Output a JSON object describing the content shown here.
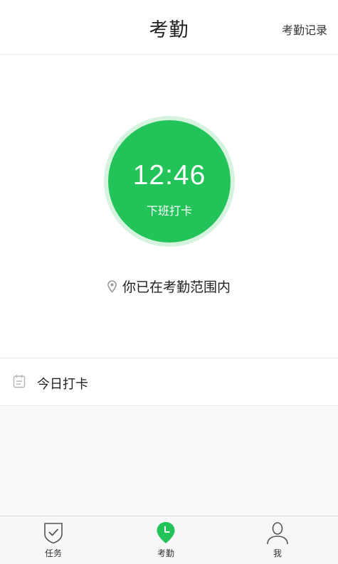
{
  "header": {
    "title": "考勤",
    "action_label": "考勤记录"
  },
  "clock": {
    "time": "12:46",
    "punch_label": "下班打卡"
  },
  "location": {
    "icon": "map-pin-icon",
    "status_text": "你已在考勤范围内"
  },
  "today": {
    "icon": "calendar-icon",
    "label": "今日打卡"
  },
  "tabbar": {
    "items": [
      {
        "label": "任务",
        "icon": "task-shield-check-icon",
        "active": false
      },
      {
        "label": "考勤",
        "icon": "clock-pin-icon",
        "active": true
      },
      {
        "label": "我",
        "icon": "user-icon",
        "active": false
      }
    ]
  },
  "colors": {
    "accent": "#22c45a",
    "accent_ring": "#d6f3e0",
    "inactive_icon": "#555555"
  }
}
